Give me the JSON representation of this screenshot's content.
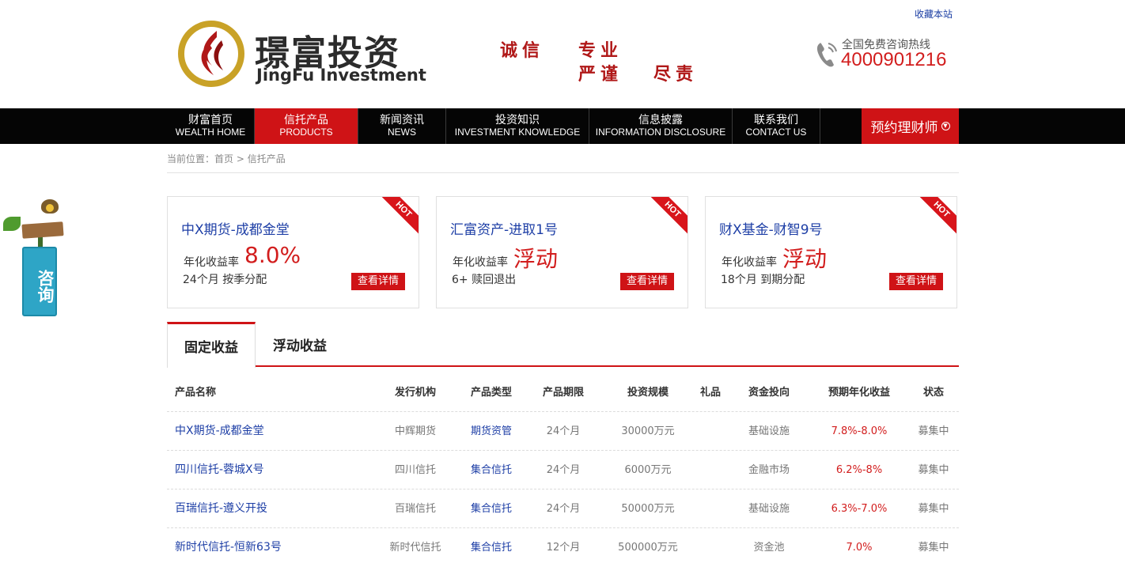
{
  "header": {
    "bookmark_label": "收藏本站",
    "logo_cn": "璟富投资",
    "logo_en": "JingFu Investment",
    "slogans": [
      "诚信",
      "专业",
      "严谨",
      "尽责"
    ],
    "hotline_label": "全国免费咨询热线",
    "hotline_number": "4000901216"
  },
  "nav": {
    "items": [
      {
        "cn": "财富首页",
        "en": "WEALTH HOME",
        "active": false
      },
      {
        "cn": "信托产品",
        "en": "PRODUCTS",
        "active": true
      },
      {
        "cn": "新闻资讯",
        "en": "NEWS",
        "active": false
      },
      {
        "cn": "投资知识",
        "en": "INVESTMENT KNOWLEDGE",
        "active": false
      },
      {
        "cn": "信息披露",
        "en": "INFORMATION DISCLOSURE",
        "active": false
      },
      {
        "cn": "联系我们",
        "en": "CONTACT US",
        "active": false
      }
    ],
    "book_label": "预约理财师",
    "book_icon": "chevron-down-circle-icon"
  },
  "breadcrumb": {
    "prefix": "当前位置：",
    "home": "首页",
    "separator": " > ",
    "current": "信托产品"
  },
  "side_float": {
    "label": "咨询"
  },
  "cards": [
    {
      "badge": "HOT",
      "title": "中X期货-成都金堂",
      "rate_label": "年化收益率",
      "rate": "8.0%",
      "meta": "24个月  按季分配",
      "button": "查看详情"
    },
    {
      "badge": "HOT",
      "title": "汇富资产-进取1号",
      "rate_label": "年化收益率",
      "rate": "浮动",
      "meta": "6+  赎回退出",
      "button": "查看详情"
    },
    {
      "badge": "HOT",
      "title": "财X基金-财智9号",
      "rate_label": "年化收益率",
      "rate": "浮动",
      "meta": "18个月  到期分配",
      "button": "查看详情"
    }
  ],
  "tabs": [
    {
      "label": "固定收益",
      "active": true
    },
    {
      "label": "浮动收益",
      "active": false
    }
  ],
  "table": {
    "headers": [
      "产品名称",
      "发行机构",
      "产品类型",
      "产品期限",
      "投资规模",
      "礼品",
      "资金投向",
      "预期年化收益",
      "状态"
    ],
    "rows": [
      [
        "中X期货-成都金堂",
        "中辉期货",
        "期货资管",
        "24个月",
        "30000万元",
        "",
        "基础设施",
        "7.8%-8.0%",
        "募集中"
      ],
      [
        "四川信托-蓉城X号",
        "四川信托",
        "集合信托",
        "24个月",
        "6000万元",
        "",
        "金融市场",
        "6.2%-8%",
        "募集中"
      ],
      [
        "百瑞信托-遵义开投",
        "百瑞信托",
        "集合信托",
        "24个月",
        "50000万元",
        "",
        "基础设施",
        "6.3%-7.0%",
        "募集中"
      ],
      [
        "新时代信托-恒新63号",
        "新时代信托",
        "集合信托",
        "12个月",
        "500000万元",
        "",
        "资金池",
        "7.0%",
        "募集中"
      ]
    ]
  },
  "colors": {
    "brand_red": "#cf1316",
    "nav_black": "#050505",
    "link_blue": "#1e3fa6",
    "logo_gold": "#c9a227"
  }
}
